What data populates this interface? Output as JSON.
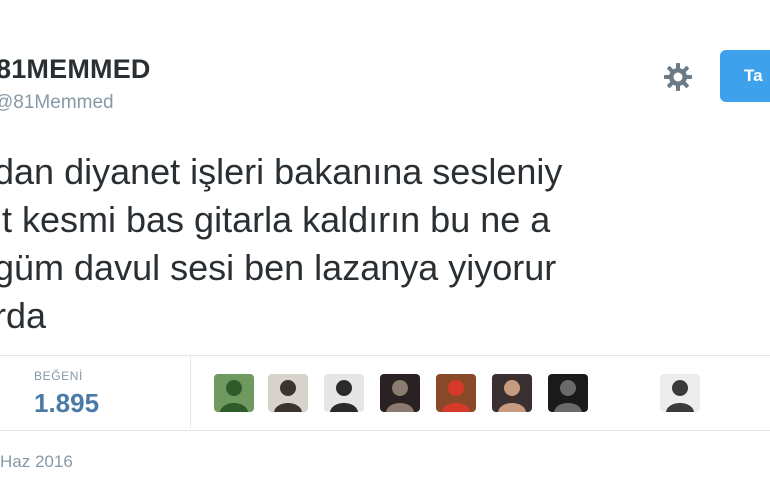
{
  "profile": {
    "display_name": "81MEMMED",
    "handle": "@81Memmed"
  },
  "header": {
    "settings_icon": "gear-icon",
    "follow_label": "Ta"
  },
  "tweet": {
    "lines": [
      "dan diyanet işleri bakanına sesleniy",
      "it kesmi bas gitarla kaldırın bu ne a",
      "güm davul sesi ben lazanya yiyorur",
      "rda"
    ]
  },
  "stats": {
    "likes_label": "BEĞENİ",
    "likes_count": "1.895"
  },
  "likers": [
    {
      "name": "avatar-1",
      "bg": "#6f9a5f",
      "fg": "#2f5a2a"
    },
    {
      "name": "avatar-2",
      "bg": "#d8d2cc",
      "fg": "#3a3330"
    },
    {
      "name": "avatar-3",
      "bg": "#e6e6e6",
      "fg": "#2a2a2a"
    },
    {
      "name": "avatar-4",
      "bg": "#2a2222",
      "fg": "#8a7a70"
    },
    {
      "name": "avatar-5",
      "bg": "#8a4a2a",
      "fg": "#d83a2a"
    },
    {
      "name": "avatar-6",
      "bg": "#3a3030",
      "fg": "#c89a80"
    },
    {
      "name": "avatar-7",
      "bg": "#1a1a1a",
      "fg": "#6a6a6a"
    },
    {
      "name": "avatar-8",
      "bg": "#ececec",
      "fg": "#3a3a3a"
    }
  ],
  "meta": {
    "timestamp": "Haz 2016"
  },
  "colors": {
    "accent": "#3ea1ec",
    "likes": "#4a7aa8",
    "muted": "#8899a6",
    "text": "#292f33"
  }
}
